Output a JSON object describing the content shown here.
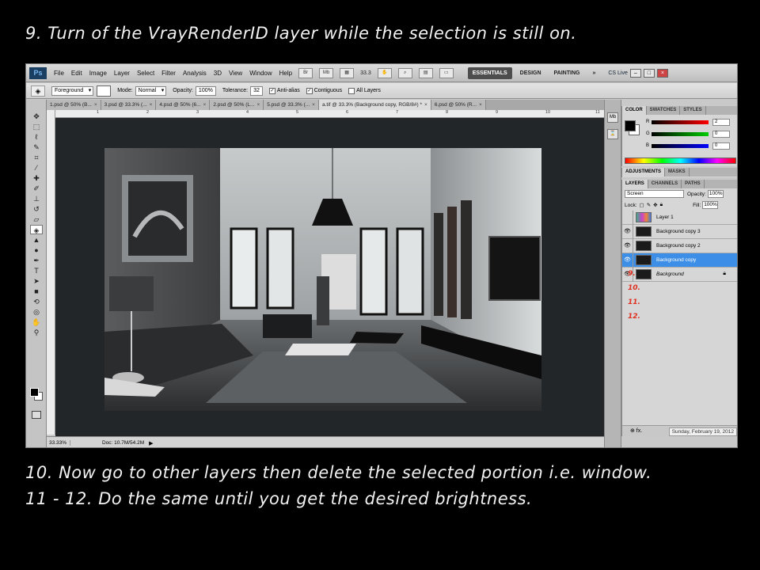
{
  "captions": {
    "top": "9. Turn of the VrayRenderID layer while the selection is still on.",
    "bottom_line1": "10. Now go to other layers then delete the selected portion i.e. window.",
    "bottom_line2": "11 - 12. Do the same until you get the desired brightness."
  },
  "app": {
    "logo": "Ps",
    "menu": [
      "File",
      "Edit",
      "Image",
      "Layer",
      "Select",
      "Filter",
      "Analysis",
      "3D",
      "View",
      "Window",
      "Help"
    ],
    "menubar_icons": [
      "Br",
      "Mb"
    ],
    "zoom": "33.3",
    "workspaces": [
      "ESSENTIALS",
      "DESIGN",
      "PAINTING"
    ],
    "workspace_more": "»",
    "cs_live": "CS Live",
    "window_controls": [
      "–",
      "□",
      "×"
    ]
  },
  "options_bar": {
    "tool_icon": "paint-bucket-icon",
    "fill_source": "Foreground",
    "mode_label": "Mode:",
    "mode_value": "Normal",
    "opacity_label": "Opacity:",
    "opacity_value": "100%",
    "tolerance_label": "Tolerance:",
    "tolerance_value": "32",
    "anti_alias": "Anti-alias",
    "contiguous": "Contiguous",
    "all_layers": "All Layers"
  },
  "doc_tabs": [
    {
      "label": "1.psd @ 50% (B...",
      "active": false
    },
    {
      "label": "3.psd @ 33.3% (...",
      "active": false
    },
    {
      "label": "4.psd @ 50% (6...",
      "active": false
    },
    {
      "label": "2.psd @ 50% (L...",
      "active": false
    },
    {
      "label": "5.psd @ 33.3% (...",
      "active": false
    },
    {
      "label": "a.tif @ 33.3% (Background copy, RGB/8#) *",
      "active": true
    },
    {
      "label": "6.psd @ 50% (R...",
      "active": false
    }
  ],
  "ruler_numbers": [
    "1",
    "2",
    "3",
    "4",
    "5",
    "6",
    "7",
    "8",
    "9",
    "10",
    "11"
  ],
  "status": {
    "zoom": "33.33%",
    "doc": "Doc: 10.7M/54.2M",
    "date": "Sunday, February 19, 2012"
  },
  "color_panel": {
    "tabs": [
      "COLOR",
      "SWATCHES",
      "STYLES"
    ],
    "channels": [
      {
        "label": "R",
        "value": "2",
        "color": "#d02020"
      },
      {
        "label": "G",
        "value": "0",
        "color": "#20a020"
      },
      {
        "label": "B",
        "value": "0",
        "color": "#2040d0"
      }
    ]
  },
  "adjustments_panel": {
    "tabs": [
      "ADJUSTMENTS",
      "MASKS"
    ]
  },
  "layers_panel": {
    "tabs": [
      "LAYERS",
      "CHANNELS",
      "PATHS"
    ],
    "blend_mode": "Screen",
    "opacity_label": "Opacity:",
    "opacity_value": "100%",
    "lock_label": "Lock:",
    "fill_label": "Fill:",
    "fill_value": "100%",
    "layers": [
      {
        "name": "Layer 1",
        "visible": false,
        "selected": false,
        "thumb": "colorful",
        "italic": false,
        "locked": false
      },
      {
        "name": "Background copy 3",
        "visible": true,
        "selected": false,
        "thumb": "dark",
        "italic": false,
        "locked": false
      },
      {
        "name": "Background copy 2",
        "visible": true,
        "selected": false,
        "thumb": "dark",
        "italic": false,
        "locked": false
      },
      {
        "name": "Background copy",
        "visible": true,
        "selected": true,
        "thumb": "dark",
        "italic": false,
        "locked": false
      },
      {
        "name": "Background",
        "visible": true,
        "selected": false,
        "thumb": "dark",
        "italic": true,
        "locked": true
      }
    ],
    "footer_icons": "⊕  fx."
  },
  "step_annotations": [
    "9.",
    "10.",
    "11.",
    "12."
  ],
  "colors": {
    "selected_layer": "#3d8ee6",
    "annotation_red": "#e03020",
    "canvas_bg": "#222628"
  }
}
